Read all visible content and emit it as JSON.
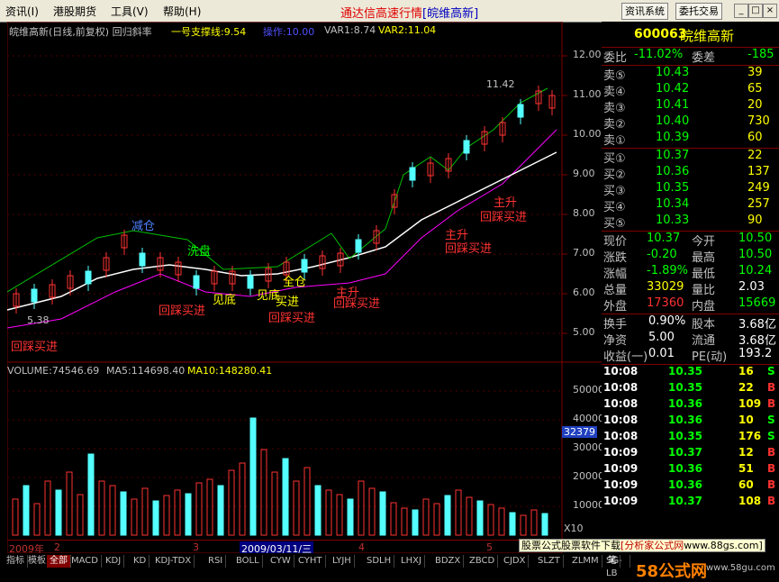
{
  "menu": {
    "items": [
      "资讯(I)",
      "港股期货",
      "工具(V)",
      "帮助(H)"
    ],
    "title_main": "通达信高速行情",
    "title_sub": "[皖维高新]",
    "btn_info": "资讯系统",
    "btn_trade": "委托交易",
    "win_min": "_",
    "win_max": "□",
    "win_close": "×"
  },
  "kline_header": {
    "name": "皖维高新(日线,前复权) 回归斜率",
    "support": "一号支撑线:9.54",
    "op": "操作:10.00",
    "var1": "VAR1:8.74",
    "var2": "VAR2:11.04"
  },
  "volume_header": {
    "vol": "VOLUME:74546.69",
    "ma5": "MA5:114698.40",
    "ma10": "MA10:148280.41"
  },
  "price_axis": [
    "12.00",
    "11.00",
    "10.00",
    "9.00",
    "8.00",
    "7.00",
    "6.00",
    "5.00"
  ],
  "volume_axis": [
    "50000",
    "40000",
    "30000",
    "20000",
    "10000"
  ],
  "volume_marker": "32379",
  "volume_unit": "X10",
  "annotations": {
    "jiancang": "减仓",
    "xipan": "洗盘",
    "jiandi": "见底",
    "jiandi2": "见底",
    "mairu": "买进",
    "quancang": "全仓",
    "zhusheng1": "主升",
    "zhusheng2": "主升",
    "zhusheng3": "主升",
    "huicai1": "回踩买进",
    "huicai2": "回踩买进",
    "huicai3": "回踩买进",
    "huicai4": "回踩买进",
    "huicai5": "回踩买进",
    "huicai6": "回踩买进",
    "high_label": "11.42",
    "low_label": "5.38"
  },
  "dates": {
    "year": "2009年",
    "m2": "2",
    "m3": "3",
    "cursor": "2009/03/11/三",
    "m4": "4",
    "m5": "5"
  },
  "quote": {
    "code": "600063",
    "name": "皖维高新",
    "weibi_label": "委比",
    "weibi": "-11.02%",
    "weicha_label": "委差",
    "weicha": "-185",
    "asks": [
      {
        "label": "卖⑤",
        "price": "10.43",
        "vol": "39"
      },
      {
        "label": "卖④",
        "price": "10.42",
        "vol": "65"
      },
      {
        "label": "卖③",
        "price": "10.41",
        "vol": "20"
      },
      {
        "label": "卖②",
        "price": "10.40",
        "vol": "730"
      },
      {
        "label": "卖①",
        "price": "10.39",
        "vol": "60"
      }
    ],
    "bids": [
      {
        "label": "买①",
        "price": "10.37",
        "vol": "22"
      },
      {
        "label": "买②",
        "price": "10.36",
        "vol": "137"
      },
      {
        "label": "买③",
        "price": "10.35",
        "vol": "249"
      },
      {
        "label": "买④",
        "price": "10.34",
        "vol": "257"
      },
      {
        "label": "买⑤",
        "price": "10.33",
        "vol": "90"
      }
    ],
    "stats": [
      {
        "l1": "现价",
        "v1": "10.37",
        "l2": "今开",
        "v2": "10.50"
      },
      {
        "l1": "涨跌",
        "v1": "-0.20",
        "l2": "最高",
        "v2": "10.50"
      },
      {
        "l1": "涨幅",
        "v1": "-1.89%",
        "l2": "最低",
        "v2": "10.24"
      },
      {
        "l1": "总量",
        "v1": "33029",
        "l2": "量比",
        "v2": "2.03"
      },
      {
        "l1": "外盘",
        "v1": "17360",
        "l2": "内盘",
        "v2": "15669"
      }
    ],
    "stats2": [
      {
        "l1": "换手",
        "v1": "0.90%",
        "l2": "股本",
        "v2": "3.68亿"
      },
      {
        "l1": "净资",
        "v1": "5.00",
        "l2": "流通",
        "v2": "3.68亿"
      },
      {
        "l1": "收益(一)",
        "v1": "0.01",
        "l2": "PE(动)",
        "v2": "193.2"
      }
    ],
    "ticks": [
      {
        "time": "10:08",
        "price": "10.35",
        "vol": "16",
        "dir": "S"
      },
      {
        "time": "10:08",
        "price": "10.35",
        "vol": "22",
        "dir": "B"
      },
      {
        "time": "10:08",
        "price": "10.36",
        "vol": "109",
        "dir": "B"
      },
      {
        "time": "10:08",
        "price": "10.36",
        "vol": "10",
        "dir": "S"
      },
      {
        "time": "10:08",
        "price": "10.35",
        "vol": "176",
        "dir": "S"
      },
      {
        "time": "10:09",
        "price": "10.37",
        "vol": "12",
        "dir": "B"
      },
      {
        "time": "10:09",
        "price": "10.36",
        "vol": "51",
        "dir": "B"
      },
      {
        "time": "10:09",
        "price": "10.36",
        "vol": "60",
        "dir": "B"
      },
      {
        "time": "10:09",
        "price": "10.37",
        "vol": "108",
        "dir": "B"
      }
    ]
  },
  "bottom_tabs": [
    "指标",
    "模板",
    "全部",
    "MACD",
    "KDJ",
    "KD",
    "KDJ-TDX",
    "RSI",
    "BOLL",
    "CYW",
    "CYHT",
    "LYJH",
    "SDLH",
    "LHXJ",
    "BDZX",
    "ZBCD",
    "CJDX",
    "SLZT",
    "ZLMM",
    "SG-LB"
  ],
  "bottom_extra": "笔",
  "ads": {
    "ad1": "股票公式股票软件下载",
    "ad2": "[分析家公式网",
    "ad3": "www.88gs.com]",
    "logo": "58公式网",
    "logo_url": "www.58gu.com"
  },
  "colors": {
    "up": "#ff3232",
    "down": "#54ffff",
    "accent": "#ff00ff",
    "yellow": "#ffff00",
    "green": "#00ff00",
    "red_text": "#ff3232"
  }
}
